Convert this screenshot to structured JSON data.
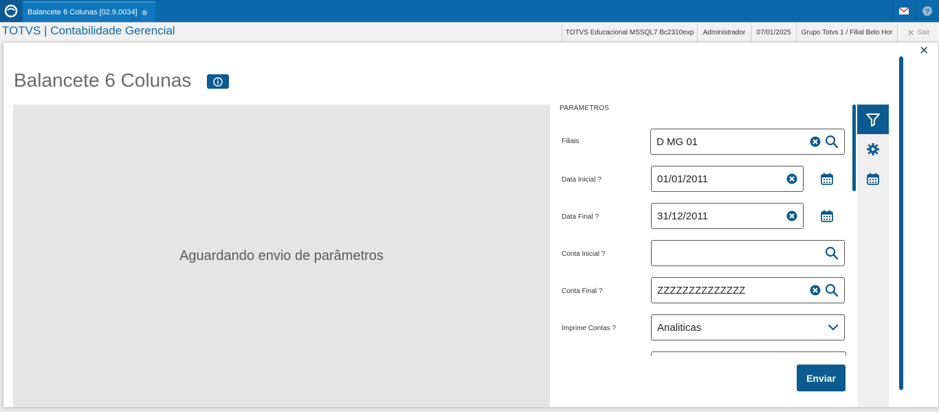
{
  "topbar": {
    "tab_label": "Balancete 6 Colunas [02.9.0034]",
    "icons": [
      "totvs-logo-icon",
      "tab-close-icon",
      "mail-icon",
      "help-icon"
    ]
  },
  "header": {
    "app_title": "TOTVS | Contabilidade Gerencial",
    "environment": "TOTVS Educacional MSSQL7 Bc2310exp",
    "user": "Administrador",
    "date": "07/01/2025",
    "branch": "Grupo Totvs 1 / Filial Belo Hor",
    "exit_label": "Sair"
  },
  "page": {
    "title": "Balancete 6 Colunas",
    "placeholder_message": "Aguardando envio de parâmetros"
  },
  "params": {
    "section_title": "PARAMETROS",
    "filiais": {
      "label": "Filiais",
      "value": "D MG 01"
    },
    "data_inicial": {
      "label": "Data Inicial ?",
      "value": "01/01/2011"
    },
    "data_final": {
      "label": "Data Final ?",
      "value": "31/12/2011"
    },
    "conta_inicial": {
      "label": "Conta Inicial ?",
      "value": ""
    },
    "conta_final": {
      "label": "Conta Final ?",
      "value": "ZZZZZZZZZZZZZZ"
    },
    "imprime_contas": {
      "label": "Imprime Contas ?",
      "value": "Analiticas"
    },
    "submit_label": "Enviar"
  },
  "colors": {
    "primary": "#0c6aac",
    "dark_blue": "#0c5b91",
    "gray_area": "#e5e5e5"
  }
}
